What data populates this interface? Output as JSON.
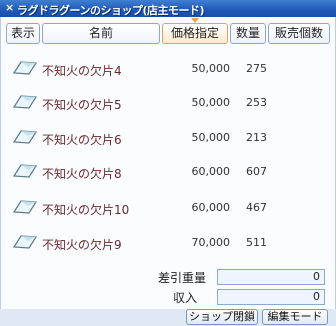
{
  "window": {
    "title": "ラグドラグーンのショップ(店主モード)",
    "title_icon": "×"
  },
  "columns": {
    "show": "表示",
    "name": "名前",
    "price": "価格指定",
    "qty": "数量",
    "sold": "販売個数"
  },
  "items": [
    {
      "name": "不知火の欠片4",
      "price": "50,000",
      "qty": "275"
    },
    {
      "name": "不知火の欠片5",
      "price": "50,000",
      "qty": "253"
    },
    {
      "name": "不知火の欠片6",
      "price": "50,000",
      "qty": "213"
    },
    {
      "name": "不知火の欠片8",
      "price": "60,000",
      "qty": "607"
    },
    {
      "name": "不知火の欠片10",
      "price": "60,000",
      "qty": "467"
    },
    {
      "name": "不知火の欠片9",
      "price": "70,000",
      "qty": "511"
    }
  ],
  "footer": {
    "weight_label": "差引重量",
    "weight_value": "0",
    "income_label": "収入",
    "income_value": "0"
  },
  "buttons": {
    "close_shop": "ショップ閉鎖",
    "edit_mode": "編集モード"
  },
  "colors": {
    "titlebar": "#1f58b8",
    "item_name": "#6b2a2a",
    "sort_marker": "#f4a04a"
  }
}
